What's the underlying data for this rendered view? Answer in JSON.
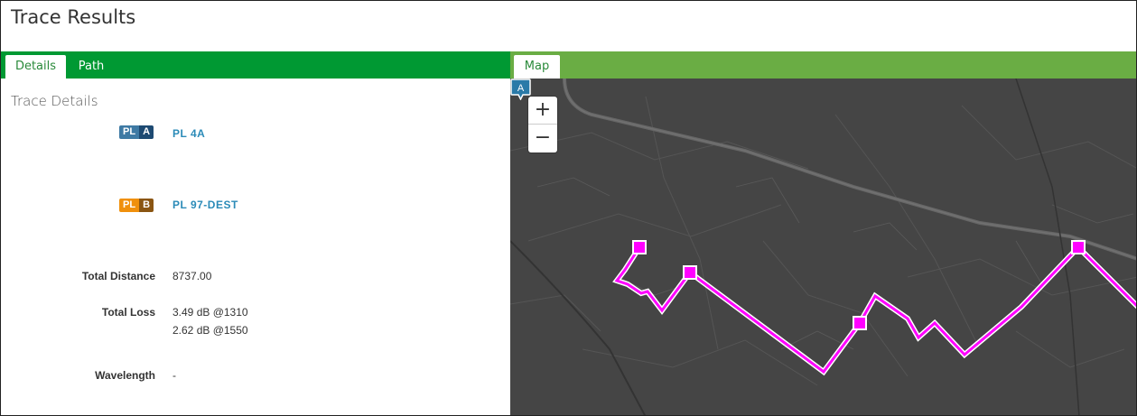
{
  "page": {
    "title": "Trace Results"
  },
  "left_tabs": [
    {
      "label": "Details",
      "active": true
    },
    {
      "label": "Path",
      "active": false
    }
  ],
  "map_tab": {
    "label": "Map"
  },
  "details": {
    "section_title": "Trace Details",
    "endpoint_a": {
      "badge_left": "PL",
      "badge_right": "A",
      "label": "PL 4A"
    },
    "endpoint_b": {
      "badge_left": "PL",
      "badge_right": "B",
      "label": "PL 97-DEST"
    },
    "total_distance": {
      "label": "Total Distance",
      "value": "8737.00"
    },
    "total_loss": {
      "label": "Total Loss",
      "value_1310": "3.49 dB @1310",
      "value_1550": "2.62 dB @1550"
    },
    "wavelength": {
      "label": "Wavelength",
      "value": "-"
    }
  },
  "map": {
    "zoom_in_label": "+",
    "zoom_out_label": "−",
    "marker_a_label": "A"
  },
  "colors": {
    "header_green": "#009933",
    "map_tab_green": "#6aad44",
    "trace_magenta": "#ff00ff",
    "link_blue": "#2b8bb8",
    "map_background": "#454545"
  }
}
